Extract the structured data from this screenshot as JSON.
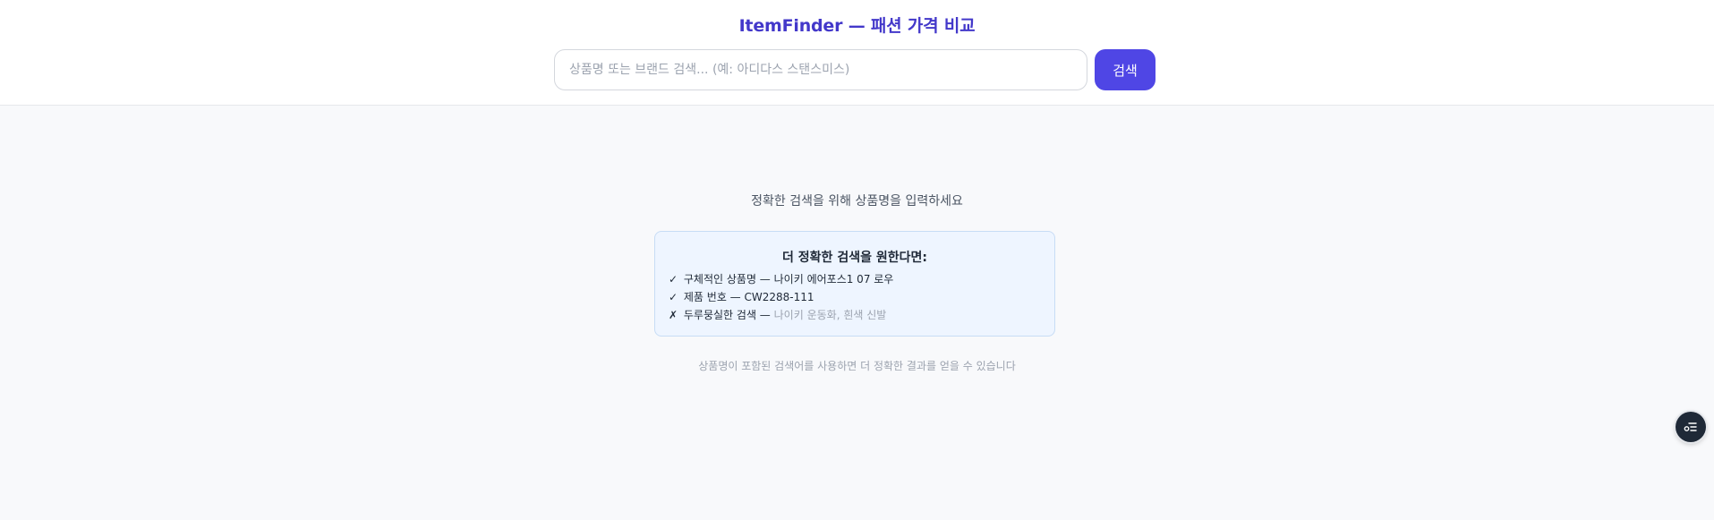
{
  "header": {
    "title": "ItemFinder — 패션 가격 비교",
    "search": {
      "placeholder": "상품명 또는 브랜드 검색... (예: 아디다스 스탠스미스)",
      "value": ""
    },
    "search_button_label": "검색"
  },
  "main": {
    "prompt": "정확한 검색을 위해 상품명을 입력하세요",
    "tips": {
      "title": "더 정확한 검색을 원한다면:",
      "items": [
        {
          "mark": "✓",
          "label": "구체적인 상품명 —",
          "example": "나이키 에어포스1 07 로우"
        },
        {
          "mark": "✓",
          "label": "제품 번호 —",
          "example": "CW2288-111"
        },
        {
          "mark": "✗",
          "label": "두루뭉실한 검색 —",
          "example": "나이키 운동화, 흰색 신발"
        }
      ]
    },
    "footnote": "상품명이 포함된 검색어를 사용하면 더 정확한 결과를 얻을 수 있습니다"
  },
  "floating_action": {
    "icon": "filter-list-icon"
  },
  "colors": {
    "accent": "#4f46e5",
    "title": "#4338ca",
    "background": "#f8f9fb",
    "tips_background": "#eef5ff",
    "tips_border": "#c7dcf5",
    "muted_text": "#9ca3af"
  }
}
